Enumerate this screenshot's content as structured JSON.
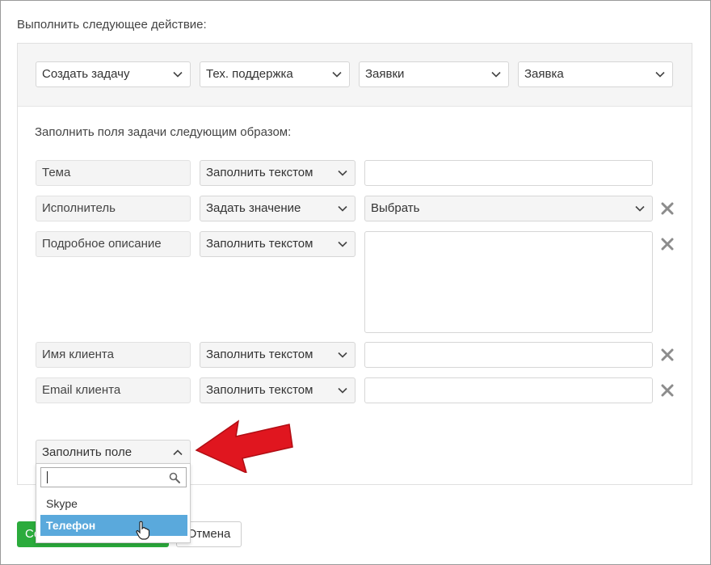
{
  "intro_text": "Выполнить следующее действие:",
  "action_selects": [
    {
      "value": "Создать задачу"
    },
    {
      "value": "Тех. поддержка"
    },
    {
      "value": "Заявки"
    },
    {
      "value": "Заявка"
    }
  ],
  "fill_text": "Заполнить поля задачи следующим образом:",
  "field_rows": [
    {
      "field": "Тема",
      "mode": "Заполнить текстом",
      "value": ""
    },
    {
      "field": "Исполнитель",
      "mode": "Задать значение",
      "value": "Выбрать"
    },
    {
      "field": "Подробное описание",
      "mode": "Заполнить текстом",
      "value": ""
    },
    {
      "field": "Имя клиента",
      "mode": "Заполнить текстом",
      "value": ""
    },
    {
      "field": "Email клиента",
      "mode": "Заполнить текстом",
      "value": ""
    }
  ],
  "fill_field_select": {
    "value": "Заполнить поле"
  },
  "dropdown": {
    "search_value": "",
    "options": [
      "Skype",
      "Телефон"
    ],
    "highlighted": "Телефон"
  },
  "footer": {
    "save_label": "Сохранить",
    "cancel_label": "Отмена"
  },
  "colors": {
    "arrow": "#e0161f",
    "save_button": "#2bab3c",
    "highlight": "#5aa9dc"
  },
  "icons": {
    "select_arrow": "chevron-down-icon",
    "open_select_arrow": "chevron-up-icon",
    "remove": "close-icon",
    "search": "search-icon",
    "pointer": "hand-cursor-icon",
    "callout": "arrow-icon"
  }
}
